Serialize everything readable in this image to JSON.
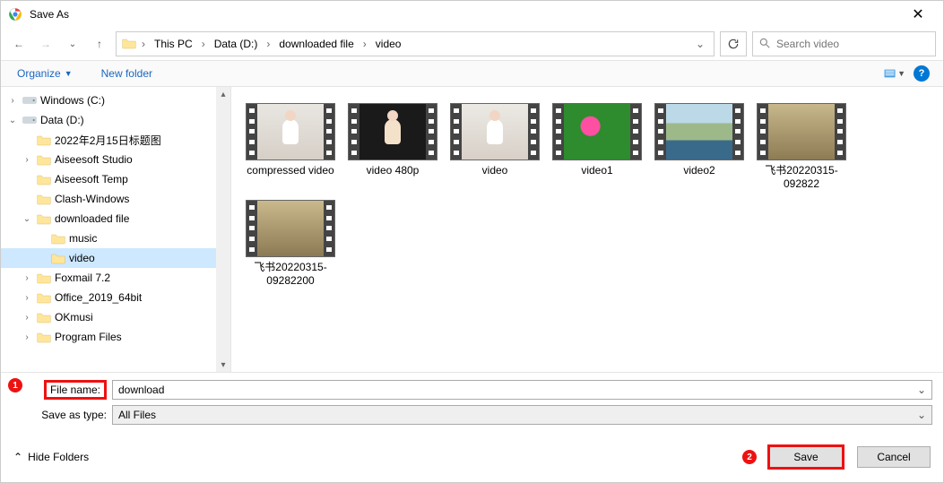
{
  "window": {
    "title": "Save As"
  },
  "breadcrumbs": {
    "b0": "This PC",
    "b1": "Data (D:)",
    "b2": "downloaded file",
    "b3": "video"
  },
  "search": {
    "placeholder": "Search video"
  },
  "toolbar": {
    "organize": "Organize",
    "newfolder": "New folder"
  },
  "tree": {
    "windowsC": "Windows (C:)",
    "dataD": "Data (D:)",
    "f0": "2022年2月15日标题图",
    "f1": "Aiseesoft Studio",
    "f2": "Aiseesoft Temp",
    "f3": "Clash-Windows",
    "f4": "downloaded file",
    "f4a": "music",
    "f4b": "video",
    "f5": "Foxmail 7.2",
    "f6": "Office_2019_64bit",
    "f7": "OKmusi",
    "f8": "Program Files"
  },
  "files": {
    "i0": "compressed video",
    "i1": "video 480p",
    "i2": "video",
    "i3": "video1",
    "i4": "video2",
    "i5": "飞书20220315-092822",
    "i6": "飞书20220315-09282200"
  },
  "form": {
    "filename_label": "File name:",
    "filename_value": "download",
    "type_label": "Save as type:",
    "type_value": "All Files"
  },
  "footer": {
    "hidefolders": "Hide Folders",
    "save": "Save",
    "cancel": "Cancel"
  },
  "annotations": {
    "n1": "1",
    "n2": "2"
  }
}
